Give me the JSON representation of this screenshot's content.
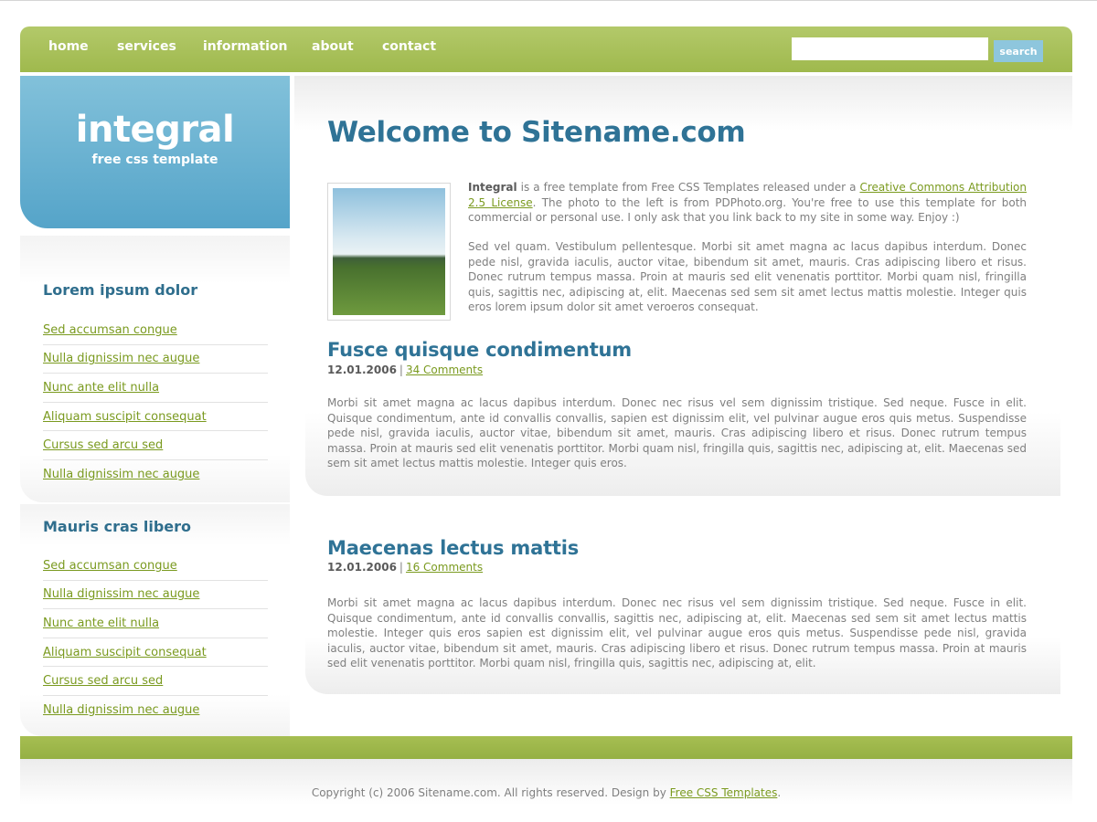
{
  "nav": {
    "items": [
      {
        "label": "home"
      },
      {
        "label": "services"
      },
      {
        "label": "information"
      },
      {
        "label": "about"
      },
      {
        "label": "contact"
      }
    ],
    "search_value": "",
    "search_button": "search"
  },
  "logo": {
    "title": "integral",
    "subtitle": "free css template"
  },
  "sidebar": {
    "sections": [
      {
        "heading": "Lorem ipsum dolor",
        "links": [
          "Sed accumsan congue",
          "Nulla dignissim nec augue",
          "Nunc ante elit nulla",
          "Aliquam suscipit consequat",
          "Cursus sed arcu sed",
          "Nulla dignissim nec augue"
        ]
      },
      {
        "heading": "Mauris cras libero",
        "links": [
          "Sed accumsan congue",
          "Nulla dignissim nec augue",
          "Nunc ante elit nulla",
          "Aliquam suscipit consequat",
          "Cursus sed arcu sed",
          "Nulla dignissim nec augue"
        ]
      }
    ]
  },
  "main": {
    "title": "Welcome to Sitename.com",
    "intro": {
      "brand": "Integral",
      "text1": " is a free template from Free CSS Templates released under a ",
      "license_link": "Creative Commons Attribution 2.5 License",
      "text2": ". The photo to the left is from PDPhoto.org. You're free to use this template for both commercial or personal use. I only ask that you link back to my site in some way. Enjoy :)",
      "paragraph2": "Sed vel quam. Vestibulum pellentesque. Morbi sit amet magna ac lacus dapibus interdum. Donec pede nisl, gravida iaculis, auctor vitae, bibendum sit amet, mauris. Cras adipiscing libero et risus. Donec rutrum tempus massa. Proin at mauris sed elit venenatis porttitor. Morbi quam nisl, fringilla quis, sagittis nec, adipiscing at, elit. Maecenas sed sem sit amet lectus mattis molestie. Integer quis eros lorem ipsum dolor sit amet veroeros consequat."
    },
    "posts": [
      {
        "title": "Fusce quisque condimentum",
        "date": "12.01.2006",
        "separator": "|",
        "comments": "34 Comments",
        "body": "Morbi sit amet magna ac lacus dapibus interdum. Donec nec risus vel sem dignissim tristique. Sed neque. Fusce in elit. Quisque condimentum, ante id convallis convallis, sapien est dignissim elit, vel pulvinar augue eros quis metus. Suspendisse pede nisl, gravida iaculis, auctor vitae, bibendum sit amet, mauris. Cras adipiscing libero et risus. Donec rutrum tempus massa. Proin at mauris sed elit venenatis porttitor. Morbi quam nisl, fringilla quis, sagittis nec, adipiscing at, elit. Maecenas sed sem sit amet lectus mattis molestie. Integer quis eros."
      },
      {
        "title": "Maecenas lectus mattis",
        "date": "12.01.2006",
        "separator": "|",
        "comments": "16 Comments",
        "body": "Morbi sit amet magna ac lacus dapibus interdum. Donec nec risus vel sem dignissim tristique. Sed neque. Fusce in elit. Quisque condimentum, ante id convallis convallis, sagittis nec, adipiscing at, elit. Maecenas sed sem sit amet lectus mattis molestie. Integer quis eros sapien est dignissim elit, vel pulvinar augue eros quis metus. Suspendisse pede nisl, gravida iaculis, auctor vitae, bibendum sit amet, mauris. Cras adipiscing libero et risus. Donec rutrum tempus massa. Proin at mauris sed elit venenatis porttitor. Morbi quam nisl, fringilla quis, sagittis nec, adipiscing at, elit."
      }
    ]
  },
  "footer": {
    "text": "Copyright (c) 2006 Sitename.com. All rights reserved. Design by ",
    "link": "Free CSS Templates",
    "end": "."
  },
  "colors": {
    "nav_green": "#a6be52",
    "logo_blue": "#55a4c9",
    "heading_blue": "#2f7396",
    "link_green": "#7a9a1f",
    "search_button": "#8ec6dd"
  }
}
